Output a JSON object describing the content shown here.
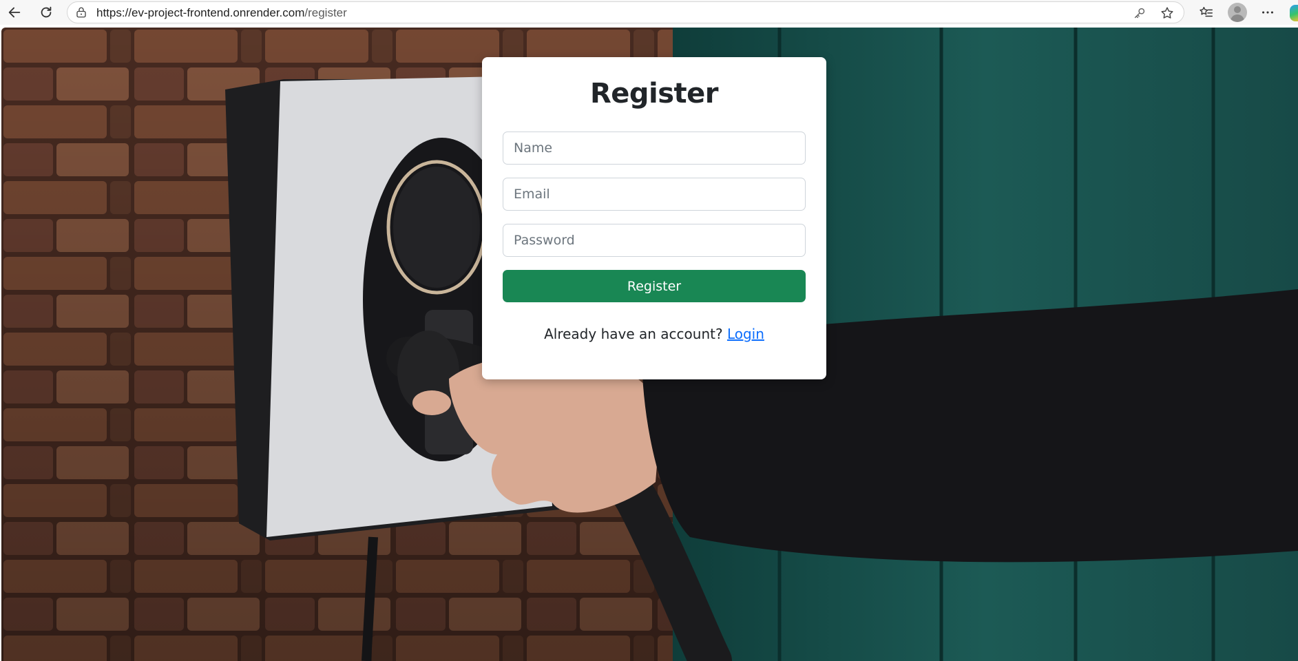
{
  "browser": {
    "url_host": "https://ev-project-frontend.onrender.com",
    "url_path": "/register",
    "icons": {
      "back": "back-arrow-icon",
      "reload": "reload-icon",
      "site_info": "site-info-lock-icon",
      "password": "key-icon",
      "favorite": "star-icon",
      "favorites_bar": "favorites-list-icon",
      "profile": "profile-avatar",
      "menu": "more-dots-icon",
      "copilot": "copilot-icon"
    }
  },
  "form": {
    "title": "Register",
    "name_placeholder": "Name",
    "email_placeholder": "Email",
    "password_placeholder": "Password",
    "submit_label": "Register",
    "footer_text": "Already have an account?",
    "login_link": "Login"
  },
  "colors": {
    "primary_button": "#198754",
    "link": "#0d6efd",
    "card_background": "#ffffff"
  }
}
